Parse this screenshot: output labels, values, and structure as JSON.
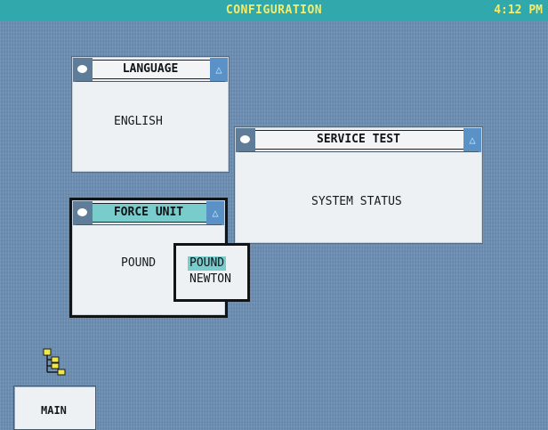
{
  "screen": {
    "title": "CONFIGURATION",
    "time": "4:12 PM"
  },
  "windows": {
    "language": {
      "title": "LANGUAGE",
      "value": "ENGLISH"
    },
    "service_test": {
      "title": "SERVICE TEST",
      "value": "SYSTEM STATUS"
    },
    "force_unit": {
      "title": "FORCE UNIT",
      "value": "POUND",
      "options": [
        "POUND",
        "NEWTON"
      ],
      "selected_option": "POUND"
    }
  },
  "taskbar": {
    "main_label": "MAIN",
    "tree_icon": "tree-icon"
  },
  "colors": {
    "title_bar": "#30a8ac",
    "title_text": "#f5ec6a",
    "desktop": "#6c8fb4",
    "focus_highlight": "#78cccc",
    "window_bg": "#eef1f3"
  }
}
